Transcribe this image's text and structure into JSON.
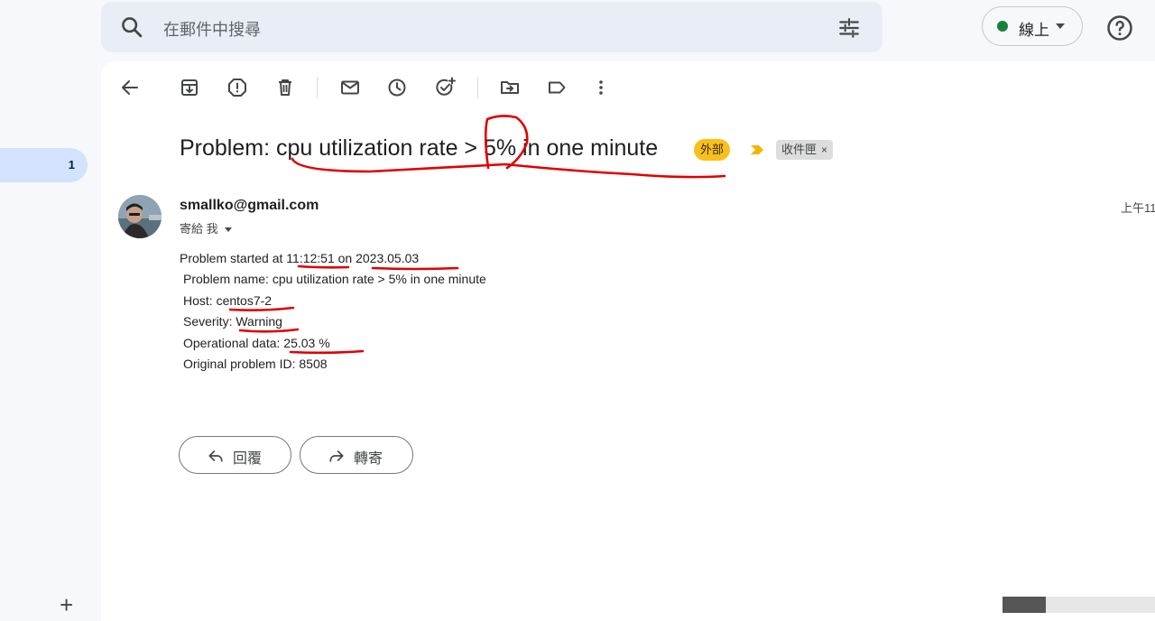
{
  "search": {
    "placeholder": "在郵件中搜尋"
  },
  "status": {
    "label": "線上",
    "color": "#188038"
  },
  "sidebar": {
    "active_count": "1"
  },
  "toolbar": {
    "icons": [
      "back-arrow-icon",
      "archive-icon",
      "report-spam-icon",
      "delete-icon",
      "mark-unread-icon",
      "snooze-icon",
      "add-task-icon",
      "move-to-icon",
      "label-icon",
      "more-options-icon"
    ]
  },
  "email": {
    "subject": "Problem: cpu utilization rate > 5% in one minute",
    "tag_external": "外部",
    "tag_inbox": "收件匣",
    "tag_inbox_close": "×",
    "sender": "smallko@gmail.com",
    "to": "寄給 我",
    "time": "上午11",
    "body": {
      "line1_prefix": "Problem started at ",
      "start_time": "11:12:51",
      "line1_mid": " on ",
      "start_date": "2023.05.03",
      "problem_name": "Problem name: cpu utilization rate > 5% in one minute",
      "host_label": "Host: ",
      "host": "centos7-2",
      "severity_label": "Severity: ",
      "severity": "Warning",
      "opdata_label": "Operational data:",
      "opdata": " 25.03 %",
      "problem_id": "Original problem ID: 8508"
    },
    "reply_label": "回覆",
    "forward_label": "轉寄"
  },
  "colors": {
    "accent_blue": "#d3e3fd",
    "tag_external": "#f9c01c",
    "annotation_red": "#e00000"
  }
}
